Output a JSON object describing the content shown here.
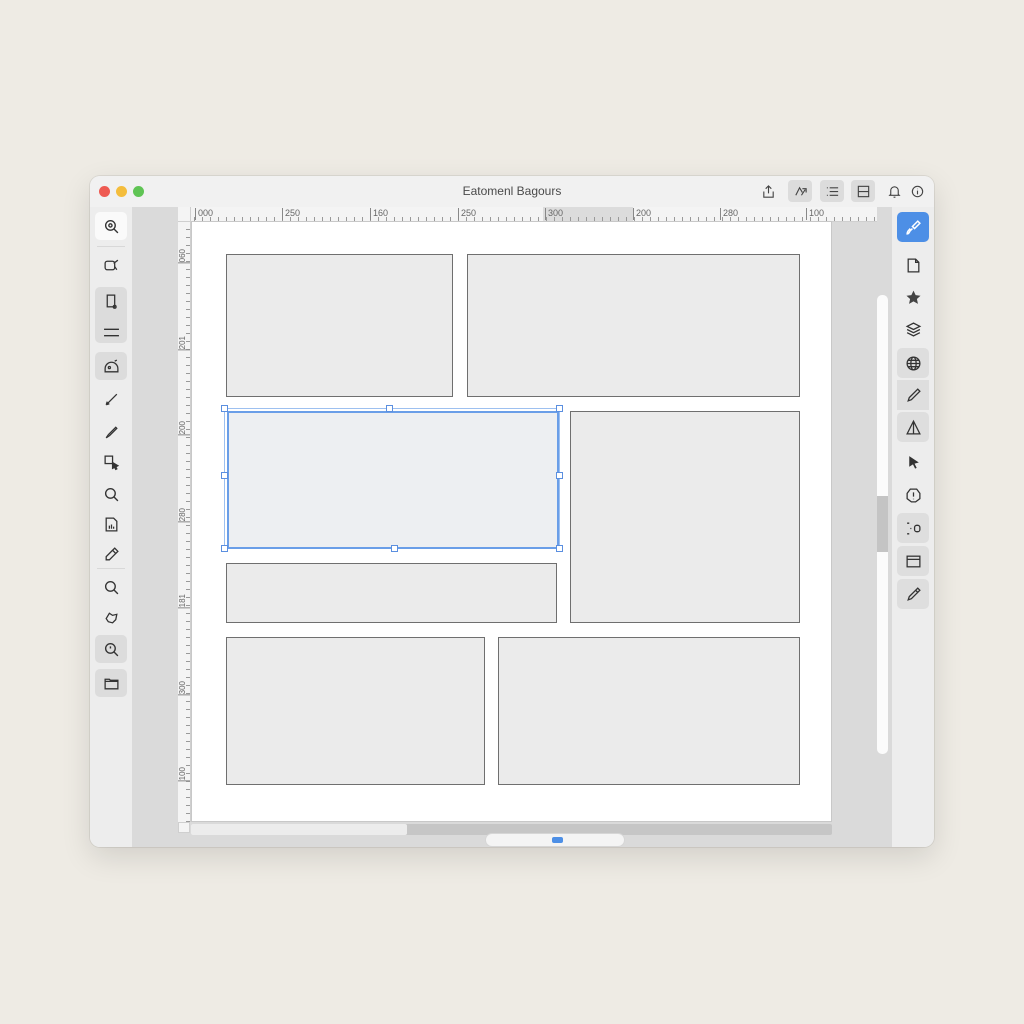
{
  "window": {
    "title": "Eatomenl Bagours"
  },
  "titlebar_actions": [
    {
      "name": "share-button",
      "icon": "share-icon"
    },
    {
      "name": "rotate-button",
      "icon": "rotate-icon"
    },
    {
      "name": "list-view-button",
      "icon": "list-icon"
    },
    {
      "name": "layout-toggle-button",
      "icon": "layout-split-icon"
    },
    {
      "name": "notifications-button",
      "icon": "bell-icon"
    },
    {
      "name": "info-button",
      "icon": "info-icon"
    }
  ],
  "left_tools": [
    {
      "name": "zoom-select-tool",
      "icon": "zoom-target-icon"
    },
    {
      "name": "lasso-tool",
      "icon": "lasso-icon"
    },
    {
      "name": "frame-tool",
      "icon": "frame-icon"
    },
    {
      "name": "line-tool",
      "icon": "lines-icon"
    },
    {
      "name": "shape-tool",
      "icon": "shape-icon"
    },
    {
      "name": "pen-tool",
      "icon": "pen-icon"
    },
    {
      "name": "brush-tool",
      "icon": "brush-icon"
    },
    {
      "name": "select-transform-tool",
      "icon": "select-icon"
    },
    {
      "name": "search-tool",
      "icon": "search-icon"
    },
    {
      "name": "document-tool",
      "icon": "document-icon"
    },
    {
      "name": "eyedropper-tool",
      "icon": "eyedropper-icon"
    },
    {
      "name": "magnify-tool",
      "icon": "magnify-icon"
    },
    {
      "name": "transform-tool",
      "icon": "transform-icon"
    },
    {
      "name": "zoom-in-tool",
      "icon": "zoom-in-icon"
    },
    {
      "name": "folder-tool",
      "icon": "folder-icon"
    }
  ],
  "right_tools": [
    {
      "name": "format-brush-tool",
      "icon": "paintbrush-icon"
    },
    {
      "name": "page-tool",
      "icon": "page-icon"
    },
    {
      "name": "favorite-tool",
      "icon": "star-icon"
    },
    {
      "name": "layers-tool",
      "icon": "layers-icon"
    },
    {
      "name": "web-tool",
      "icon": "globe-icon"
    },
    {
      "name": "pencil-tool",
      "icon": "pencil-icon"
    },
    {
      "name": "triangle-tool",
      "icon": "triangle-icon"
    },
    {
      "name": "pointer-tool",
      "icon": "cursor-icon"
    },
    {
      "name": "alert-tool",
      "icon": "alert-icon"
    },
    {
      "name": "node-tool",
      "icon": "node-icon"
    },
    {
      "name": "window-tool",
      "icon": "window-icon"
    },
    {
      "name": "edit-tool",
      "icon": "edit-pencil-icon"
    }
  ],
  "ruler_top": [
    "000",
    "250",
    "160",
    "250",
    "300",
    "200",
    "280",
    "100"
  ],
  "ruler_left": [
    "060",
    "201",
    "200",
    "280",
    "181",
    "300",
    "100"
  ],
  "panels": [
    {
      "name": "panel-1"
    },
    {
      "name": "panel-2"
    },
    {
      "name": "panel-3",
      "selected": true
    },
    {
      "name": "panel-4"
    },
    {
      "name": "panel-5"
    },
    {
      "name": "panel-6"
    },
    {
      "name": "panel-7"
    }
  ],
  "colors": {
    "accent": "#4d8fe6",
    "selection": "#6a9ee8",
    "panel_fill": "#ebebeb",
    "panel_border": "#6f6f6f"
  }
}
